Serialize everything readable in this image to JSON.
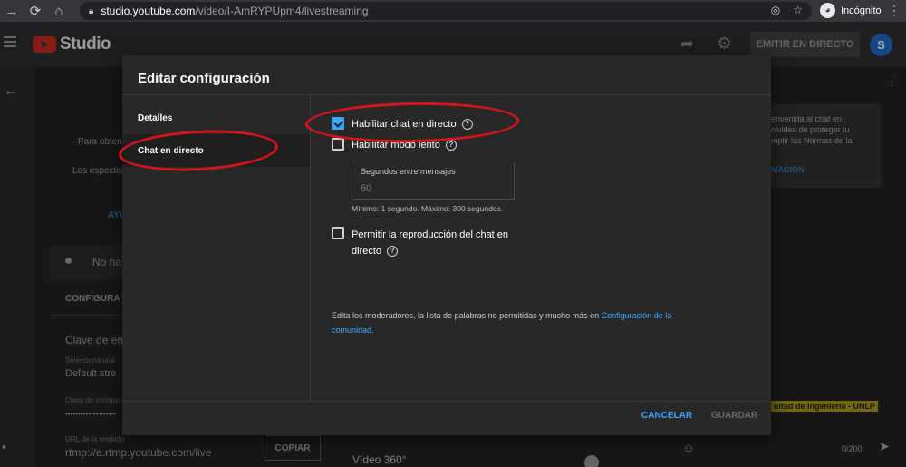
{
  "browser": {
    "url_domain": "studio.youtube.com",
    "url_path": "/video/I-AmRYPUpm4/livestreaming",
    "incognito_label": "Incógnito"
  },
  "header": {
    "logo_text": "Studio",
    "go_live_label": "EMITIR EN DIRECTO",
    "avatar_letter": "S"
  },
  "background": {
    "left_text_1": "Para obtene",
    "left_text_2": "Los espectad",
    "link_text": "AYU",
    "status_text": "No ha",
    "config_tab": "CONFIGURA",
    "stream_key_title": "Clave de em",
    "select_label": "Selecciona una",
    "select_value": "Default stre",
    "key_label": "Clave de emisión",
    "key_dots": "••••••••••••••••••••",
    "url_label": "URL de la emisión",
    "url_value": "rtmp://a.rtmp.youtube.com/live",
    "copy_label": "COPIAR",
    "video360_label": "Vídeo 360°",
    "chat_line_1": "envenida al chat en",
    "chat_line_2": "olvides de proteger tu",
    "chat_line_3": "mplir las Normas de la",
    "chat_link": "MACION",
    "badge": "ultad de Ingeniería - UNLP",
    "chat_counter": "0/200"
  },
  "modal": {
    "title": "Editar configuración",
    "sidebar": {
      "items": [
        {
          "label": "Detalles"
        },
        {
          "label": "Chat en directo"
        }
      ]
    },
    "enable_chat_label": "Habilitar chat en directo",
    "slow_mode_label": "Habilitar modo lento",
    "seconds_field_label": "Segundos entre mensajes",
    "seconds_field_value": "60",
    "seconds_hint": "Mínimo: 1 segundo. Máximo: 300 segundos.",
    "replay_label": "Permitir la reproducción del chat en directo",
    "footnote_text": "Edita los moderadores, la lista de palabras no permitidas y mucho más en ",
    "footnote_link": "Configuración de la comunidad",
    "footnote_end": ".",
    "cancel_label": "CANCELAR",
    "save_label": "GUARDAR"
  },
  "state": {
    "enable_chat_checked": true,
    "slow_mode_checked": false,
    "replay_checked": false
  },
  "colors": {
    "accent": "#3ea6ff",
    "annotation": "#d6141b"
  }
}
